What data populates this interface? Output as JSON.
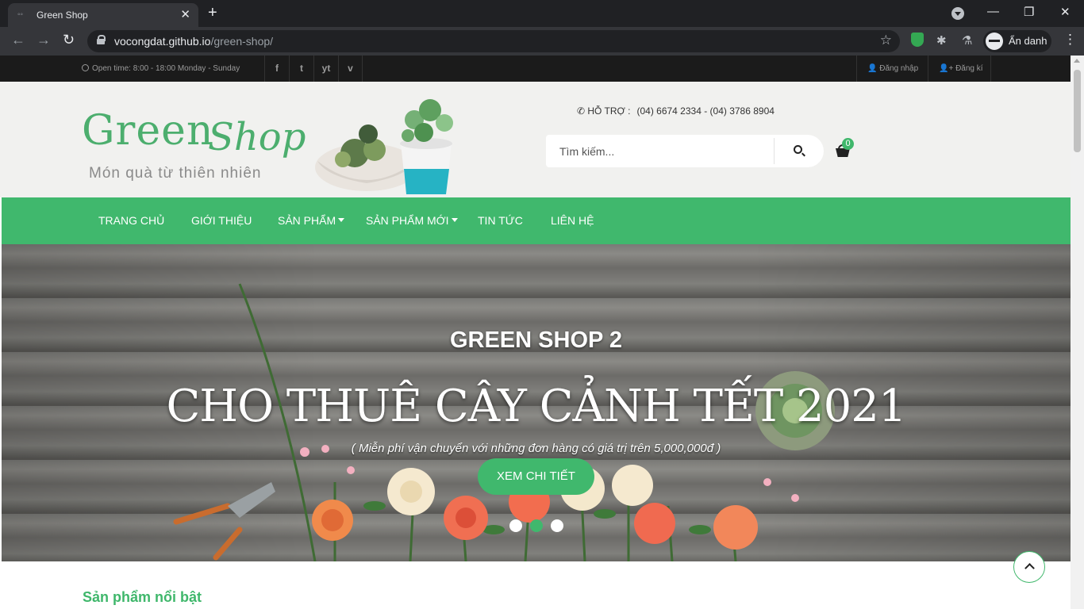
{
  "browser": {
    "tab_title": "Green Shop",
    "url_host": "vocongdat.github.io",
    "url_path": "/green-shop/",
    "profile_label": "Ẩn danh"
  },
  "topbar": {
    "hours": "Open time: 8:00 - 18:00 Monday - Sunday",
    "social": [
      "f",
      "t",
      "yt",
      "v"
    ],
    "login": "Đăng nhập",
    "register": "Đăng kí"
  },
  "header": {
    "logo_main": "Green",
    "logo_script": "Shop",
    "tagline": "Món quà từ thiên nhiên",
    "support_label": "HỖ TRỢ :",
    "support_phones": "(04) 6674 2334 - (04) 3786 8904",
    "search_placeholder": "Tìm kiếm...",
    "cart_count": "0"
  },
  "nav": {
    "items": [
      "TRANG CHỦ",
      "GIỚI THIỆU",
      "SẢN PHẨM",
      "SẢN PHẨM MỚI",
      "TIN TỨC",
      "LIÊN HỆ"
    ]
  },
  "hero": {
    "subtitle": "GREEN SHOP 2",
    "headline": "CHO THUÊ CÂY CẢNH TẾT 2021",
    "note": "( Miễn phí vận chuyển với những đơn hàng có giá trị trên 5,000,000đ )",
    "cta": "XEM CHI TIẾT",
    "active_slide": 2
  },
  "section": {
    "featured_title": "Sản phẩm nổi bật"
  },
  "colors": {
    "brand_green": "#40b86d",
    "topbar_bg": "#1b1b1b",
    "header_bg": "#f1f1ef"
  }
}
